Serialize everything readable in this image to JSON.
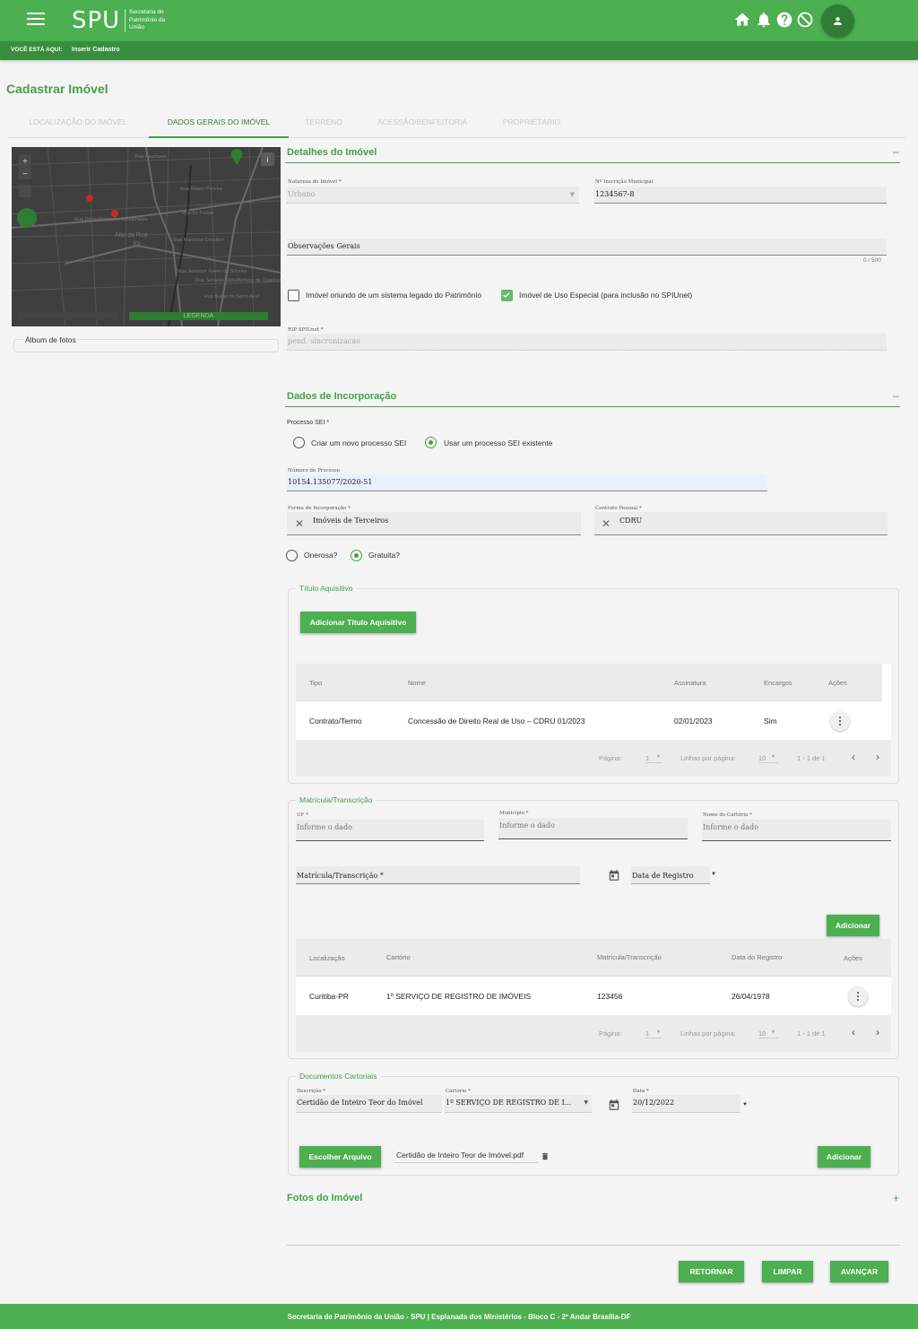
{
  "header": {
    "logo": "SPU",
    "logo_sub": "Secretaria do Patrimônio da União",
    "breadcrumb_label": "VOCÊ ESTÁ AQUI:",
    "breadcrumb_current": "Inserir Cadastro"
  },
  "page_title": "Cadastrar Imóvel",
  "tabs": [
    {
      "label": "Localização do Imóvel"
    },
    {
      "label": "Dados Gerais do Imóvel"
    },
    {
      "label": "Terreno"
    },
    {
      "label": "Acessão/Benfeitoria"
    },
    {
      "label": "Proprietário"
    }
  ],
  "map": {
    "legend_label": "LEGENDA",
    "streets": [
      "Rua Riachuelo",
      "Rua Ébano Pereira",
      "Rua Desembargador Westphalen",
      "Rua Marechal Deodoro",
      "Rua Senador Xavier da Silveira",
      "Alto da Rua XV",
      "Rua Dr. Faivre",
      "Rua Senador Schafferberg de Quadros",
      "Rua Barão do Serro Azul"
    ]
  },
  "album_label": "Álbum de fotos",
  "detalhes": {
    "title": "Detalhes do Imóvel",
    "toggle": "–",
    "natureza_label": "Natureza do Imóvel *",
    "natureza_value": "Urbano",
    "inscricao_label": "Nº Inscrição Municipal",
    "inscricao_value": "1234567-8",
    "observacoes_label": "Observações Gerais",
    "char_count": "0 / 500",
    "legado_label": "Imóvel oriundo de um sistema legado do Patrimônio",
    "uso_especial_label": "Imóvel de Uso Especial (para inclusão no SPIUnet)",
    "rip_label": "RIP SPIUnet *",
    "rip_value": "pend. sincronizacao"
  },
  "incorporacao": {
    "title": "Dados de Incorporação",
    "toggle": "–",
    "processo_label": "Processo SEI *",
    "radio_novo": "Criar um novo processo SEI",
    "radio_existente": "Usar um processo SEI existente",
    "numero_label": "Número do Processo",
    "numero_value": "10154.135077/2020-51",
    "forma_label": "Forma de Incorporação *",
    "forma_value": "Imóveis de Terceiros",
    "contrato_label": "Contrato Pessoal *",
    "contrato_value": "CDRU",
    "onerosa": "Onerosa?",
    "gratuita": "Gratuita?"
  },
  "titulo": {
    "legend": "Título Aquisitivo",
    "add_button": "Adicionar Título Aquisitivo",
    "columns": [
      "Tipo",
      "Nome",
      "Assinatura",
      "Encargos",
      "Ações"
    ],
    "rows": [
      {
        "tipo": "Contrato/Termo",
        "nome": "Concessão de Direito Real de Uso – CDRU 01/2023",
        "assinatura": "02/01/2023",
        "encargos": "Sim"
      }
    ],
    "footer": {
      "pagina_label": "Página:",
      "pagina_value": "1",
      "linhas_label": "Linhas por página:",
      "linhas_value": "10",
      "range": "1 - 1 de 1"
    }
  },
  "matricula": {
    "legend": "Matrícula/Transcrição",
    "uf_label": "UF *",
    "municipio_label": "Município *",
    "cartorio_label": "Nome do Cartório *",
    "placeholder": "Informe o dado",
    "matricula_label": "Matrícula/Transcrição *",
    "data_registro": "Data de Registro",
    "add_button": "Adicionar",
    "columns": [
      "Localização",
      "Cartório",
      "Matrícula/Transcrição",
      "Data do Registro",
      "Ações"
    ],
    "rows": [
      {
        "localizacao": "Curitiba-PR",
        "cartorio": "1º SERVIÇO DE REGISTRO DE IMÓVEIS",
        "matricula": "123456",
        "data": "26/04/1978"
      }
    ],
    "footer": {
      "pagina_label": "Página:",
      "pagina_value": "1",
      "linhas_label": "Linhas por página:",
      "linhas_value": "10",
      "range": "1 - 1 de 1"
    }
  },
  "documentos": {
    "legend": "Documentos Cartoriais",
    "descricao_label": "Descrição *",
    "descricao_value": "Certidão de Inteiro Teor do Imóvel",
    "cartorio_label": "Cartorio *",
    "cartorio_value": "1º SERVIÇO DE REGISTRO DE I...",
    "data_label": "Data *",
    "data_value": "20/12/2022",
    "choose_button": "Escolher Arquivo",
    "file_name": "Certidão de Inteiro Teor de Imóvel.pdf",
    "add_button": "Adicionar"
  },
  "fotos": {
    "title": "Fotos do Imóvel",
    "toggle": "+"
  },
  "actions": {
    "retornar": "RETORNAR",
    "limpar": "LIMPAR",
    "avancar": "AVANÇAR"
  },
  "footer_text": "Secretaria de Patrimônio da União - SPU | Esplanada dos Ministérios - Bloco C - 2º Andar Brasília-DF",
  "colors": {
    "primary": "#4caf50",
    "primary_dark": "#388e3c",
    "accent_text": "#43a047"
  }
}
